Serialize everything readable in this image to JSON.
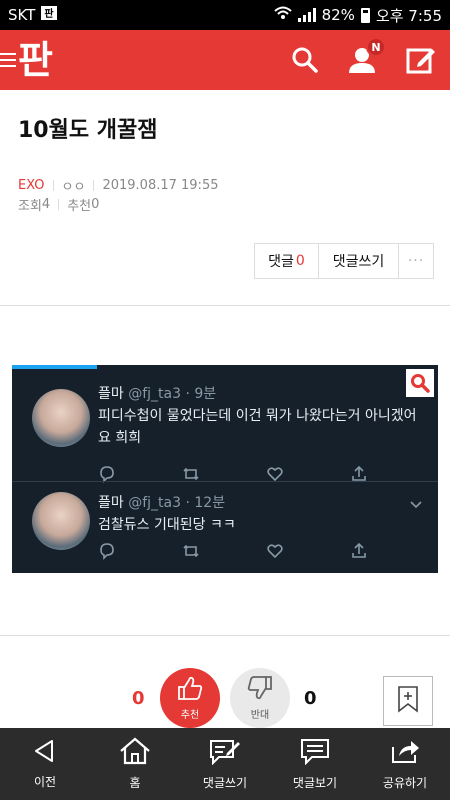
{
  "status_bar": {
    "carrier": "SKT",
    "carrier_icon": "pann-app-icon",
    "battery": "82%",
    "time": "오후 7:55"
  },
  "app_bar": {
    "logo": "판",
    "notification_badge": "N",
    "icons": [
      "menu-icon",
      "search-icon",
      "profile-icon",
      "write-icon"
    ],
    "accent_color": "#e53935"
  },
  "post": {
    "title": "10월도 개꿀잼",
    "category": "EXO",
    "author": "ㅇㅇ",
    "datetime": "2019.08.17 19:55",
    "views_label": "조회",
    "views": "4",
    "recommend_label": "추천",
    "recommend": "0"
  },
  "comment_bar": {
    "comments_label": "댓글",
    "comments_count": "0",
    "write_label": "댓글쓰기",
    "more_label": "···"
  },
  "tweets": [
    {
      "name": "플마",
      "handle": "@fj_ta3",
      "time": "9분",
      "text": "피디수첩이 물었다는데 이건 뭐가 나왔다는거 아니겠어요 희희"
    },
    {
      "name": "플마",
      "handle": "@fj_ta3",
      "time": "12분",
      "text": "검찰듀스 기대된당 ㅋㅋ"
    }
  ],
  "vote": {
    "up_count": "0",
    "up_label": "추천",
    "down_count": "0",
    "down_label": "반대"
  },
  "bottom_nav": [
    {
      "label": "이전",
      "icon": "back-icon"
    },
    {
      "label": "홈",
      "icon": "home-icon"
    },
    {
      "label": "댓글쓰기",
      "icon": "write-comment-icon"
    },
    {
      "label": "댓글보기",
      "icon": "view-comments-icon"
    },
    {
      "label": "공유하기",
      "icon": "share-icon"
    }
  ]
}
